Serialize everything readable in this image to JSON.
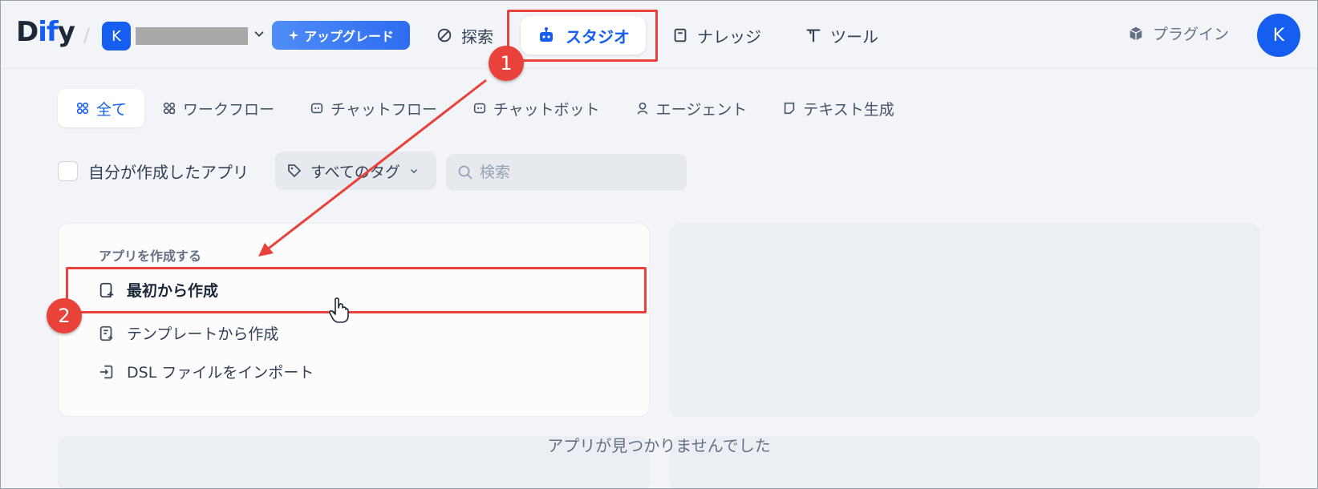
{
  "header": {
    "logo": {
      "prefix": "D",
      "accent": "if",
      "suffix": "y"
    },
    "workspace": {
      "initial": "K"
    },
    "upgrade_label": "アップグレード",
    "nav": {
      "explore": "探索",
      "studio": "スタジオ",
      "knowledge": "ナレッジ",
      "tools": "ツール"
    },
    "plugin_label": "プラグイン",
    "user_initial": "K"
  },
  "tabs": [
    {
      "label": "全て",
      "active": true
    },
    {
      "label": "ワークフロー",
      "active": false
    },
    {
      "label": "チャットフロー",
      "active": false
    },
    {
      "label": "チャットボット",
      "active": false
    },
    {
      "label": "エージェント",
      "active": false
    },
    {
      "label": "テキスト生成",
      "active": false
    }
  ],
  "filters": {
    "mine_label": "自分が作成したアプリ",
    "tag_label": "すべてのタグ",
    "search_placeholder": "検索"
  },
  "create_card": {
    "heading": "アプリを作成する",
    "items": [
      "最初から作成",
      "テンプレートから作成",
      "DSL ファイルをインポート"
    ]
  },
  "empty_message": "アプリが見つかりませんでした",
  "annotations": {
    "badge_1": "1",
    "badge_2": "2",
    "color": "#e8423a"
  },
  "colors": {
    "accent": "#155eef",
    "background": "#f2f4f7"
  }
}
